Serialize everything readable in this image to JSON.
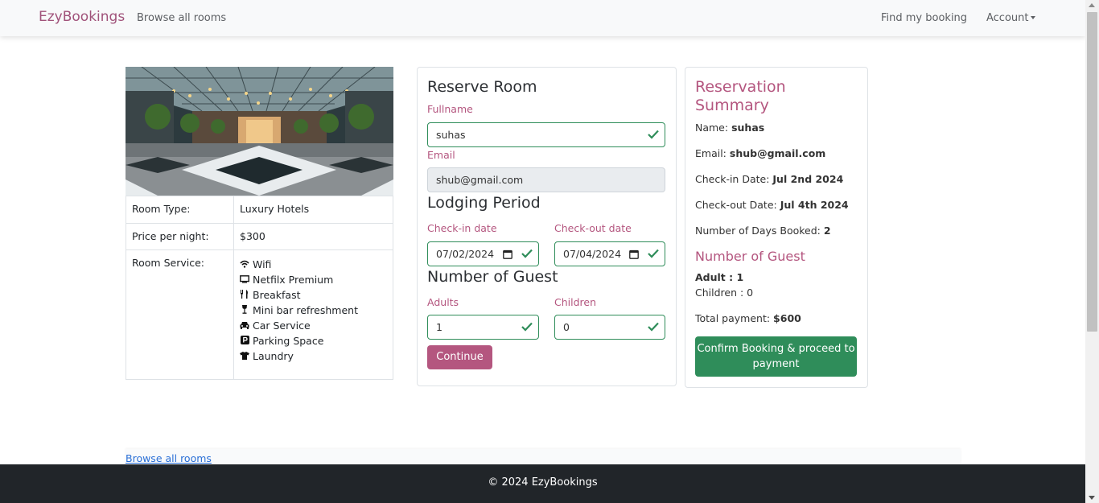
{
  "navbar": {
    "brand": "EzyBookings",
    "browse_link": "Browse all rooms",
    "find_booking_link": "Find my booking",
    "account_link": "Account"
  },
  "room": {
    "image_icon": "hotel-lobby-photo",
    "rows": [
      {
        "label": "Room Type:",
        "value": "Luxury Hotels"
      },
      {
        "label": "Price per night:",
        "value": "$300"
      }
    ],
    "service_label": "Room Service:",
    "services": [
      {
        "icon": "wifi-icon",
        "label": "Wifi"
      },
      {
        "icon": "tv-icon",
        "label": "Netfilx Premium"
      },
      {
        "icon": "cutlery-icon",
        "label": "Breakfast"
      },
      {
        "icon": "wine-glass-icon",
        "label": "Mini bar refreshment"
      },
      {
        "icon": "car-icon",
        "label": "Car Service"
      },
      {
        "icon": "parking-icon",
        "label": "Parking Space"
      },
      {
        "icon": "tshirt-icon",
        "label": "Laundry"
      }
    ]
  },
  "reserve": {
    "title": "Reserve Room",
    "fullname_label": "Fullname",
    "fullname_value": "suhas",
    "email_label": "Email",
    "email_value": "shub@gmail.com",
    "lodging_title": "Lodging Period",
    "checkin_label": "Check-in date",
    "checkin_value": "07/02/2024",
    "checkout_label": "Check-out date",
    "checkout_value": "07/04/2024",
    "guest_title": "Number of Guest",
    "adults_label": "Adults",
    "adults_value": "1",
    "children_label": "Children",
    "children_value": "0",
    "continue_label": "Continue"
  },
  "summary": {
    "title": "Reservation Summary",
    "name_label": "Name:",
    "name_value": "suhas",
    "email_label": "Email:",
    "email_value": "shub@gmail.com",
    "checkin_label": "Check-in Date:",
    "checkin_value": "Jul 2nd 2024",
    "checkout_label": "Check-out Date:",
    "checkout_value": "Jul 4th 2024",
    "days_label": "Number of Days Booked:",
    "days_value": "2",
    "guest_title": "Number of Guest",
    "adult_text": "Adult : 1",
    "children_text": "Children : 0",
    "total_label": "Total payment:",
    "total_value": "$600",
    "confirm_label": "Confirm Booking & proceed to payment"
  },
  "bottom_link": "Browse all rooms",
  "footer": "© 2024 EzyBookings",
  "colors": {
    "brand": "#a0527a",
    "accent": "#b4567f",
    "success": "#2f8d5a",
    "footer": "#212529"
  }
}
